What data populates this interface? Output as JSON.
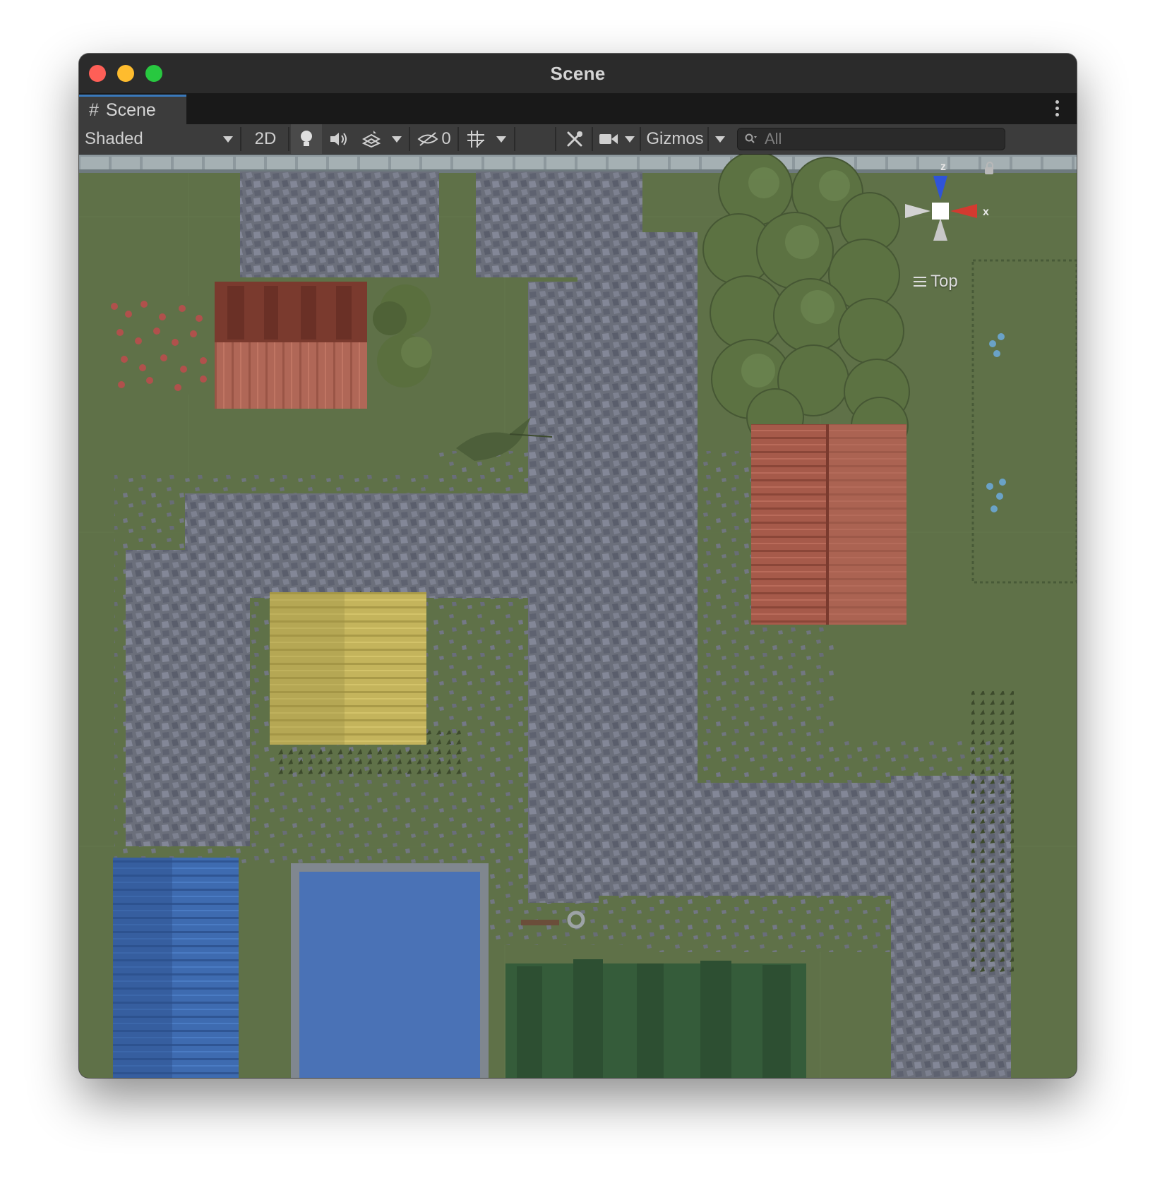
{
  "window": {
    "title": "Scene"
  },
  "tab": {
    "label": "Scene",
    "icon": "hash-icon"
  },
  "toolbar": {
    "shading_mode": "Shaded",
    "mode_2d": "2D",
    "hidden_count": "0",
    "gizmos_label": "Gizmos",
    "search_placeholder": "All"
  },
  "gizmo": {
    "axis_z": "z",
    "axis_x": "x",
    "view_label": "Top"
  },
  "colors": {
    "ground": "#5f7148",
    "stone": "#747888",
    "red_roof": "#a85a4a",
    "yellow_roof": "#c9b85f",
    "blue_roof": "#3f6cb0",
    "water": "#4a72b6",
    "tree": "#5c7242",
    "hedge": "#355c3a"
  }
}
